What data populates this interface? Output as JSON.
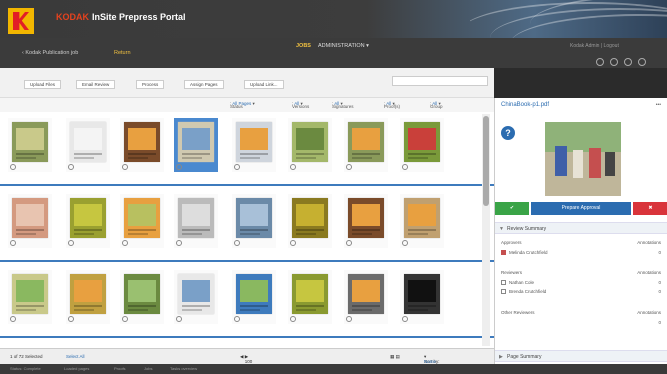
{
  "header": {
    "brand": "KODAK",
    "title": "InSite Prepress Portal"
  },
  "nav": {
    "back_label": "Kodak Publication job",
    "current_label": "Return",
    "jobs_label": "JOBS",
    "admin_label": "ADMINISTRATION",
    "user_label": "Kodak Admin | Logout"
  },
  "toolbar": {
    "buttons": [
      "Upload Files",
      "Email Review",
      "Process",
      "Assign Pages",
      "Upload Link..."
    ]
  },
  "filters": {
    "status_label": "Status",
    "status_value": "All Pages",
    "versions_label": "Versions",
    "versions_value": "All",
    "signatures_label": "Signatures",
    "signatures_value": "All",
    "proofs_label": "Proof(s)",
    "proofs_value": "All",
    "group_label": "Group",
    "group_value": "All"
  },
  "footer": {
    "pages_info": "1 of 72 Selected",
    "select_all": "Select All",
    "zoom": "100",
    "sort_label": "Sort by:",
    "sort_value": "Name"
  },
  "panel": {
    "title": "ChinaBook-p1.pdf",
    "approve_label": "Prepare Approval",
    "review_summary_label": "Review Summary",
    "approvers_label": "Approvers",
    "approvers_count_label": "Annotations",
    "approver_name": "Melinda Crutchfield",
    "reviewers_label": "Reviewers",
    "reviewers_count_label": "Annotations",
    "reviewer_1": "Nathan Cole",
    "reviewer_2": "Brenda Crutchfield",
    "other_reviewers_label": "Other Reviewers",
    "other_count_label": "Annotations",
    "page_summary_label": "Page Summary",
    "approver_count": "0",
    "reviewer_1_count": "0",
    "reviewer_2_count": "0",
    "other_count": "0"
  },
  "status_bar": {
    "items": [
      "Status: Complete",
      "Loaded pages",
      "Proofs",
      "Jobs",
      "Tasks overview"
    ]
  },
  "colors": {
    "accent_blue": "#2b6cb0",
    "approve_green": "#3aa447",
    "reject_red": "#d9343b",
    "kodak_yellow": "#f2b600",
    "kodak_red": "#e21f26"
  }
}
